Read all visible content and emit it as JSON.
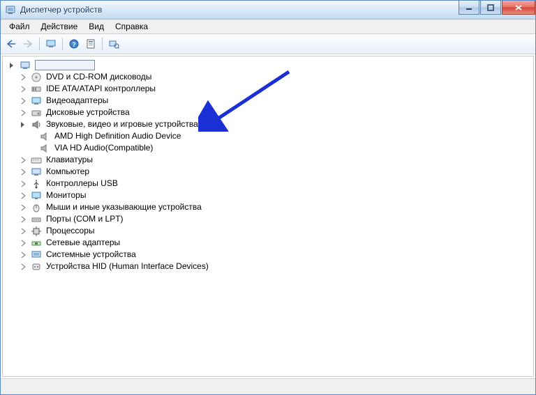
{
  "window": {
    "title": "Диспетчер устройств"
  },
  "menu": {
    "file": "Файл",
    "action": "Действие",
    "view": "Вид",
    "help": "Справка"
  },
  "tree": {
    "root": "",
    "categories": [
      {
        "label": "DVD и CD-ROM дисководы",
        "expanded": false
      },
      {
        "label": "IDE ATA/ATAPI контроллеры",
        "expanded": false
      },
      {
        "label": "Видеоадаптеры",
        "expanded": false
      },
      {
        "label": "Дисковые устройства",
        "expanded": false
      },
      {
        "label": "Звуковые, видео и игровые устройства",
        "expanded": true,
        "children": [
          {
            "label": "AMD High Definition Audio Device"
          },
          {
            "label": "VIA HD Audio(Compatible)"
          }
        ]
      },
      {
        "label": "Клавиатуры",
        "expanded": false
      },
      {
        "label": "Компьютер",
        "expanded": false
      },
      {
        "label": "Контроллеры USB",
        "expanded": false
      },
      {
        "label": "Мониторы",
        "expanded": false
      },
      {
        "label": "Мыши и иные указывающие устройства",
        "expanded": false
      },
      {
        "label": "Порты (COM и LPT)",
        "expanded": false
      },
      {
        "label": "Процессоры",
        "expanded": false
      },
      {
        "label": "Сетевые адаптеры",
        "expanded": false
      },
      {
        "label": "Системные устройства",
        "expanded": false
      },
      {
        "label": "Устройства HID (Human Interface Devices)",
        "expanded": false
      }
    ]
  }
}
